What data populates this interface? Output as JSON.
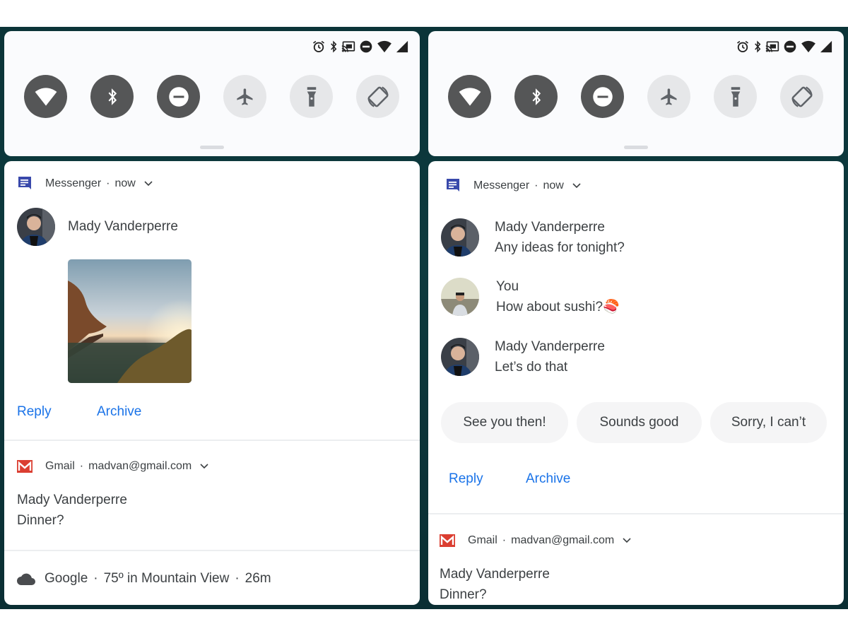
{
  "status_bar": {
    "icons": [
      "alarm-icon",
      "bluetooth-icon",
      "cast-icon",
      "do-not-disturb-icon",
      "wifi-icon",
      "signal-icon"
    ]
  },
  "quick_settings": {
    "tiles": [
      {
        "name": "wifi",
        "icon": "wifi-icon",
        "state": "on"
      },
      {
        "name": "bluetooth",
        "icon": "bluetooth-icon",
        "state": "on"
      },
      {
        "name": "do-not-disturb",
        "icon": "do-not-disturb-icon",
        "state": "on"
      },
      {
        "name": "airplane-mode",
        "icon": "airplane-icon",
        "state": "off"
      },
      {
        "name": "flashlight",
        "icon": "flashlight-icon",
        "state": "off"
      },
      {
        "name": "auto-rotate",
        "icon": "rotate-icon",
        "state": "off"
      }
    ]
  },
  "colors": {
    "tile_on": "#555657",
    "tile_off": "#e6e7e9",
    "action_blue": "#1a73e8",
    "messenger_blue": "#3949ab",
    "gmail_red": "#db3e31",
    "background": "#0b3438"
  },
  "left": {
    "messenger": {
      "app": "Messenger",
      "sep": "·",
      "time": "now",
      "sender": "Mady Vanderperre",
      "image_alt": "cliff sunset landscape photo",
      "actions": [
        "Reply",
        "Archive"
      ]
    },
    "gmail": {
      "app": "Gmail",
      "sep": "·",
      "account": "madvan@gmail.com",
      "sender": "Mady Vanderperre",
      "subject": "Dinner?"
    },
    "weather": {
      "app": "Google",
      "sep1": "·",
      "text": "75º in Mountain View",
      "sep2": "·",
      "time": "26m"
    }
  },
  "right": {
    "messenger": {
      "app": "Messenger",
      "sep": "·",
      "time": "now",
      "messages": [
        {
          "sender": "Mady Vanderperre",
          "text": "Any ideas for tonight?"
        },
        {
          "sender": "You",
          "text": "How about sushi?",
          "emoji": "🍣"
        },
        {
          "sender": "Mady Vanderperre",
          "text": "Let’s do that"
        }
      ],
      "smart_replies": [
        "See you then!",
        "Sounds good",
        "Sorry, I can’t"
      ],
      "actions": [
        "Reply",
        "Archive"
      ]
    },
    "gmail": {
      "app": "Gmail",
      "sep": "·",
      "account": "madvan@gmail.com",
      "sender": "Mady Vanderperre",
      "subject": "Dinner?"
    }
  }
}
